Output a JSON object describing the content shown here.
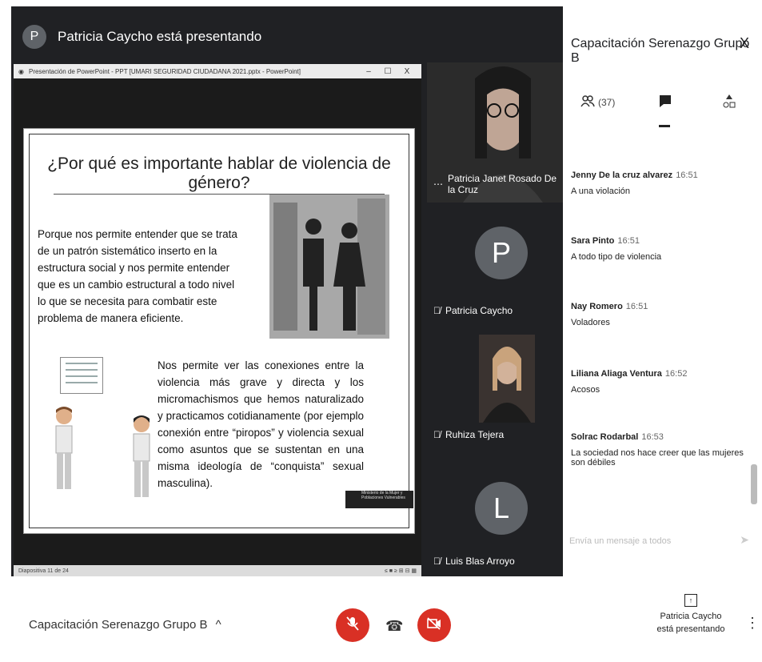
{
  "header": {
    "avatar_letter": "P",
    "presenting_text": "Patricia Caycho está presentando"
  },
  "ppt": {
    "window_title": "Presentación de PowerPoint - PPT [UMARI SEGURIDAD CIUDADANA 2021.pptx - PowerPoint]",
    "min": "–",
    "max": "☐",
    "close": "X",
    "status_left": "Diapositiva 11 de 24",
    "status_right": "≤  ■  ≥   ⊞  ⊟  ▦"
  },
  "slide": {
    "title": "¿Por qué es importante hablar de violencia de género?",
    "paragraph1": "Porque nos permite entender que se trata de un patrón sistemático inserto en la estructura social y nos permite entender que es un cambio estructural a todo nivel lo que se necesita para combatir este problema de manera eficiente.",
    "paragraph2": "Nos permite ver las conexiones entre la violencia más grave y directa y los micromachismos que hemos naturalizado y practicamos cotidianamente (por ejemplo conexión entre “piropos” y violencia sexual como asuntos que se sustentan en una misma ideología de “conquista” sexual masculina).",
    "logo_text": "Ministerio de la Mujer y Poblaciones Vulnerables"
  },
  "participants": [
    {
      "name": "Patricia Janet Rosado De la Cruz",
      "icon": "more-icon"
    },
    {
      "name": "Patricia Caycho",
      "letter": "P",
      "icon": "mic-off-icon"
    },
    {
      "name": "Ruhiza Tejera",
      "icon": "mic-off-icon"
    },
    {
      "name": "Luis Blas Arroyo",
      "letter": "L",
      "icon": "mic-off-icon"
    }
  ],
  "chat": {
    "title": "Capacitación Serenazgo Grupo B",
    "close": "X",
    "people_count": "(37)",
    "messages": [
      {
        "sender": "Jenny De la cruz alvarez",
        "time": "16:51",
        "text": "A una violación"
      },
      {
        "sender": "Sara Pinto",
        "time": "16:51",
        "text": "A todo tipo de violencia"
      },
      {
        "sender": "Nay Romero",
        "time": "16:51",
        "text": "Voladores"
      },
      {
        "sender": "Liliana Aliaga Ventura",
        "time": "16:52",
        "text": "Acosos"
      },
      {
        "sender": "Solrac Rodarbal",
        "time": "16:53",
        "text": "La sociedad nos hace creer que las mujeres son débiles"
      }
    ],
    "input_placeholder": "Envía un mensaje a todos"
  },
  "bottom": {
    "meeting_name": "Capacitación Serenazgo Grupo B",
    "chevron": "^",
    "present_line1": "Patricia Caycho",
    "present_line2": "está presentando"
  },
  "colors": {
    "danger": "#d93025",
    "dark": "#202124",
    "tile": "#3c4043"
  }
}
